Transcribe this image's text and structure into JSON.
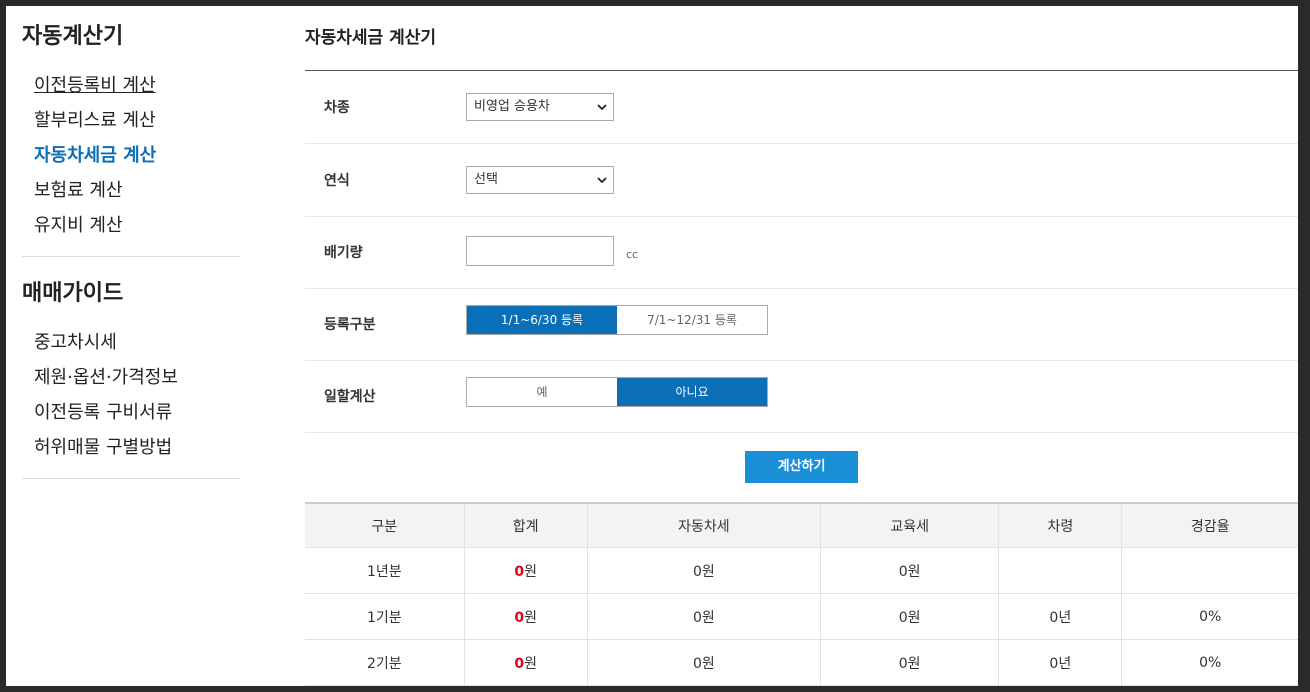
{
  "sidebar": {
    "section1_title": "자동계산기",
    "items1": [
      "이전등록비 계산",
      "할부리스료 계산",
      "자동차세금 계산",
      "보험료 계산",
      "유지비 계산"
    ],
    "section2_title": "매매가이드",
    "items2": [
      "중고차시세",
      "제원·옵션·가격정보",
      "이전등록 구비서류",
      "허위매물 구별방법"
    ]
  },
  "main": {
    "title": "자동차세금 계산기",
    "rows": {
      "car_type": {
        "label": "차종",
        "value": "비영업 승용차"
      },
      "year": {
        "label": "연식",
        "value": "선택"
      },
      "displacement": {
        "label": "배기량",
        "value": "",
        "unit": "cc"
      },
      "registration": {
        "label": "등록구분",
        "options": [
          "1/1~6/30 등록",
          "7/1~12/31 등록"
        ],
        "selected": 0
      },
      "prorate": {
        "label": "일할계산",
        "options": [
          "예",
          "아니요"
        ],
        "selected": 1
      }
    },
    "calc_button": "계산하기",
    "table": {
      "headers": [
        "구분",
        "합계",
        "자동차세",
        "교육세",
        "차령",
        "경감율"
      ],
      "rows": [
        {
          "label": "1년분",
          "total_num": "0",
          "total_unit": "원",
          "tax": "0원",
          "edu": "0원",
          "age": "",
          "rate": ""
        },
        {
          "label": "1기분",
          "total_num": "0",
          "total_unit": "원",
          "tax": "0원",
          "edu": "0원",
          "age": "0년",
          "rate": "0%"
        },
        {
          "label": "2기분",
          "total_num": "0",
          "total_unit": "원",
          "tax": "0원",
          "edu": "0원",
          "age": "0년",
          "rate": "0%"
        }
      ]
    }
  },
  "colors": {
    "accent": "#0a6fb7",
    "button": "#1b8fd6",
    "highlight": "#e60012"
  },
  "icons": {
    "select_arrow": "chevron-down-icon"
  }
}
